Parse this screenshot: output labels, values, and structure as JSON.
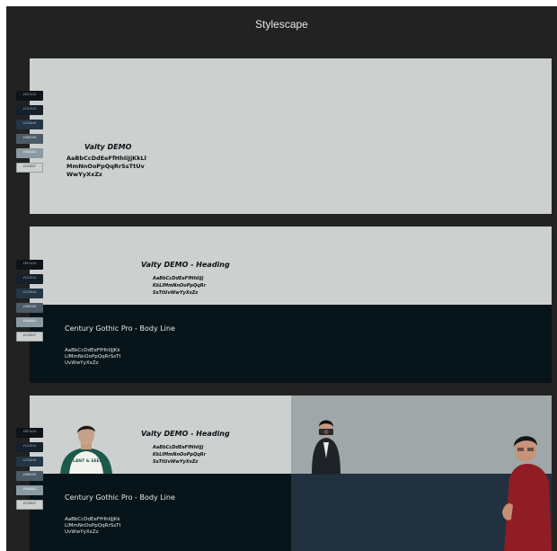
{
  "window": {
    "title": "Stylescape"
  },
  "swatches": [
    "#0E1418",
    "#15202A",
    "#233646",
    "#4B5C68",
    "#8A9AA2",
    "#CCD0CF"
  ],
  "panel1": {
    "display_title": "Valty DEMO",
    "display_alphabet": "AaBbCcDdEeFfHhIiJjKkLl MmNnOoPpQqRrSsTtUv WwYyXxZz"
  },
  "panel2": {
    "heading_title": "Valty DEMO - Heading",
    "heading_alphabet": "AaBbCcDdEeFfHhIiJj KkLlMmNnOoPpQqRr SsTtUvWwYyXxZz",
    "body_title": "Century Gothic Pro - Body Line",
    "body_alphabet": "AaBbCcDdEeFfHhIiJjKk LlMmNnOoPpQqRrSsTt UvWwYyXxZz"
  },
  "panel3": {
    "heading_title": "Valty DEMO - Heading",
    "heading_alphabet": "AaBbCcDdEeFfHhIiJj KkLlMmNnOoPpQqRr SsTtUvWwYyXxZz",
    "body_title": "Century Gothic Pro - Body Line",
    "body_alphabet": "AaBbCcDdEeFfHhIiJjKk LlMmNnOoPpQqRrSsTt UvWwYyXxZz",
    "shirt_text": "PLANT & SEED"
  }
}
